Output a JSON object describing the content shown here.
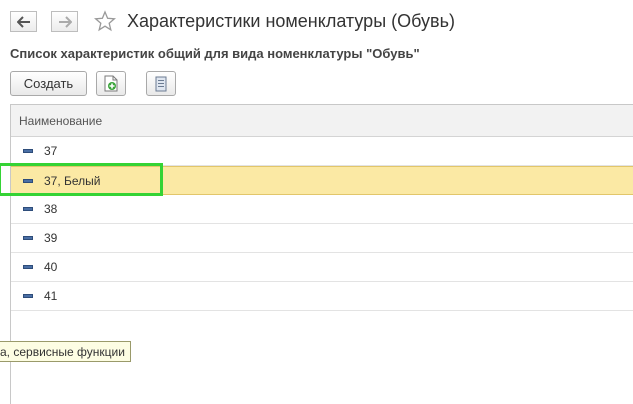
{
  "header": {
    "title": "Характеристики номенклатуры (Обувь)",
    "subtitle": "Список характеристик общий для вида номенклатуры \"Обувь\""
  },
  "toolbar": {
    "create_label": "Создать"
  },
  "table": {
    "column_header": "Наименование",
    "rows": [
      {
        "name": "37"
      },
      {
        "name": "37, Белый"
      },
      {
        "name": "38"
      },
      {
        "name": "39"
      },
      {
        "name": "40"
      },
      {
        "name": "41"
      }
    ],
    "selected_row_name": "37, Белый"
  },
  "tooltip": {
    "text": "а, сервисные функции"
  },
  "icons": {
    "back": "arrow-left-icon",
    "forward": "arrow-right-icon",
    "favorite": "star-icon",
    "copy": "add-document-icon",
    "list": "list-icon",
    "row": "item-dash-icon"
  },
  "colors": {
    "selected_row": "#fbe9a4",
    "highlight_frame": "#35d335"
  }
}
